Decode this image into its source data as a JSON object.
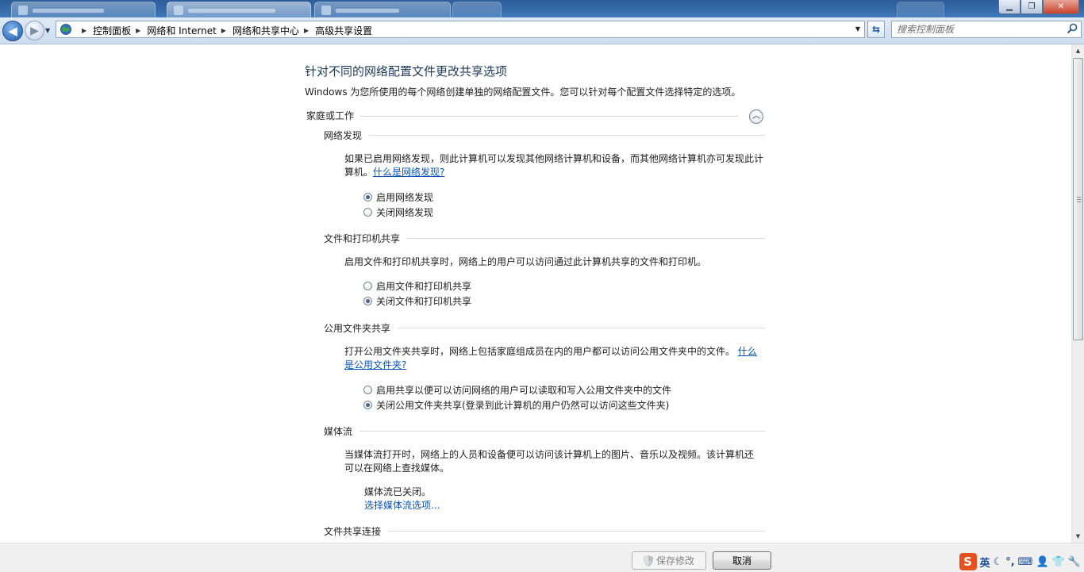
{
  "window": {
    "controls": {
      "minimize_icon": "minimize-icon",
      "maximize_icon": "restore-icon",
      "close_icon": "close-icon"
    }
  },
  "address_bar": {
    "breadcrumbs": [
      "控制面板",
      "网络和 Internet",
      "网络和共享中心",
      "高级共享设置"
    ]
  },
  "search": {
    "placeholder": "搜索控制面板"
  },
  "page": {
    "title": "针对不同的网络配置文件更改共享选项",
    "description": "Windows 为您所使用的每个网络创建单独的网络配置文件。您可以针对每个配置文件选择特定的选项。",
    "profile_group": "家庭或工作",
    "sections": {
      "network_discovery": {
        "title": "网络发现",
        "desc": "如果已启用网络发现，则此计算机可以发现其他网络计算机和设备，而其他网络计算机亦可发现此计算机。",
        "link": "什么是网络发现?",
        "options": [
          "启用网络发现",
          "关闭网络发现"
        ],
        "selected_index": 0
      },
      "file_printer_sharing": {
        "title": "文件和打印机共享",
        "desc": "启用文件和打印机共享时，网络上的用户可以访问通过此计算机共享的文件和打印机。",
        "options": [
          "启用文件和打印机共享",
          "关闭文件和打印机共享"
        ],
        "selected_index": 1
      },
      "public_folder_sharing": {
        "title": "公用文件夹共享",
        "desc": "打开公用文件夹共享时，网络上包括家庭组成员在内的用户都可以访问公用文件夹中的文件。",
        "link_part1": "什么",
        "link_part2": "是公用文件夹?",
        "options": [
          "启用共享以便可以访问网络的用户可以读取和写入公用文件夹中的文件",
          "关闭公用文件夹共享(登录到此计算机的用户仍然可以访问这些文件夹)"
        ],
        "selected_index": 1
      },
      "media_streaming": {
        "title": "媒体流",
        "desc_line1": "当媒体流打开时，网络上的人员和设备便可以访问该计算机上的图片、音乐以及视频。该计算机还",
        "desc_line2": "可以在网络上查找媒体。",
        "status": "媒体流已关闭。",
        "link": "选择媒体流选项..."
      },
      "file_sharing_connections": {
        "title": "文件共享连接"
      }
    }
  },
  "buttons": {
    "save": "保存修改",
    "cancel": "取消"
  },
  "tray": {
    "ime_logo": "S",
    "ime_label": "英"
  },
  "colors": {
    "title_text": "#1e395b",
    "link": "#0b53b5",
    "titlebar": "#3f78b8"
  }
}
